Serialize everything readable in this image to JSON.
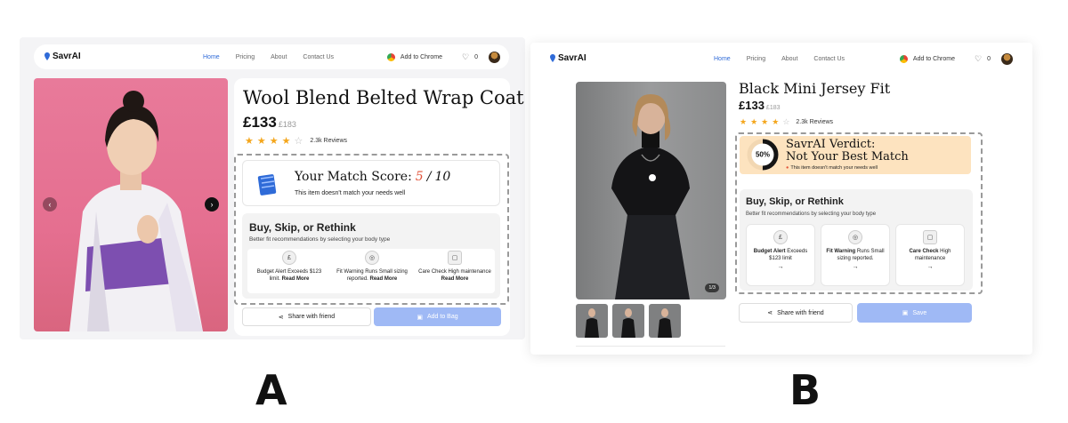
{
  "labels": {
    "a": "A",
    "b": "B"
  },
  "a": {
    "nav": {
      "logo": "SavrAI",
      "links": [
        "Home",
        "Pricing",
        "About",
        "Contact Us"
      ],
      "chrome": "Add to Chrome",
      "wishlist_count": "0"
    },
    "product": {
      "title": "Wool Blend Belted Wrap Coat",
      "price": "£133",
      "old_price": "£183",
      "rating": 4,
      "reviews": "2.3k Reviews"
    },
    "match": {
      "heading": "Your Match Score:",
      "score": "5",
      "out_of": "10",
      "subtitle": "This item doesn't match your needs well"
    },
    "rethink": {
      "title": "Buy, Skip, or Rethink",
      "subtitle": "Better fit recommendations by selecting your body type",
      "items": [
        {
          "icon": "money-icon",
          "line1": "Budget Alert Exceeds $123",
          "line2": "limit.",
          "more": "Read More"
        },
        {
          "icon": "tape-measure-icon",
          "line1": "Fit Warning Runs Small sizing",
          "line2": "reported.",
          "more": "Read More"
        },
        {
          "icon": "care-label-icon",
          "line1": "Care Check High maintenance",
          "line2": "",
          "more": "Read More"
        }
      ]
    },
    "actions": {
      "share": "Share with friend",
      "primary": "Add to Bag"
    }
  },
  "b": {
    "nav": {
      "logo": "SavrAI",
      "links": [
        "Home",
        "Pricing",
        "About",
        "Contact Us"
      ],
      "chrome": "Add to Chrome",
      "wishlist_count": "0"
    },
    "product": {
      "title": "Black Mini Jersey Fit",
      "price": "£133",
      "old_price": "£183",
      "rating": 4,
      "reviews": "2.3k Reviews"
    },
    "image_counter": "1/3",
    "verdict": {
      "percent": "50%",
      "percent_value": 50,
      "line1": "SavrAI Verdict:",
      "line2": "Not Your Best Match",
      "note": "This item doesn't match your needs well"
    },
    "rethink": {
      "title": "Buy, Skip, or Rethink",
      "subtitle": "Better fit recommendations by selecting your body type",
      "items": [
        {
          "icon": "money-icon",
          "bold": "Budget Alert",
          "rest": "Exceeds $123 limit",
          "arrow": "→"
        },
        {
          "icon": "tape-measure-icon",
          "bold": "Fit Warning",
          "rest": "Runs Small sizing reported.",
          "arrow": "→"
        },
        {
          "icon": "care-label-icon",
          "bold": "Care Check",
          "rest": "High maintenance",
          "arrow": "→"
        }
      ]
    },
    "actions": {
      "share": "Share with friend",
      "primary": "Save"
    }
  },
  "colors": {
    "accent": "#2f6bd8",
    "star": "#f4a61c",
    "cta": "#9fb9f5",
    "verdict_bg": "#fde3bf"
  }
}
